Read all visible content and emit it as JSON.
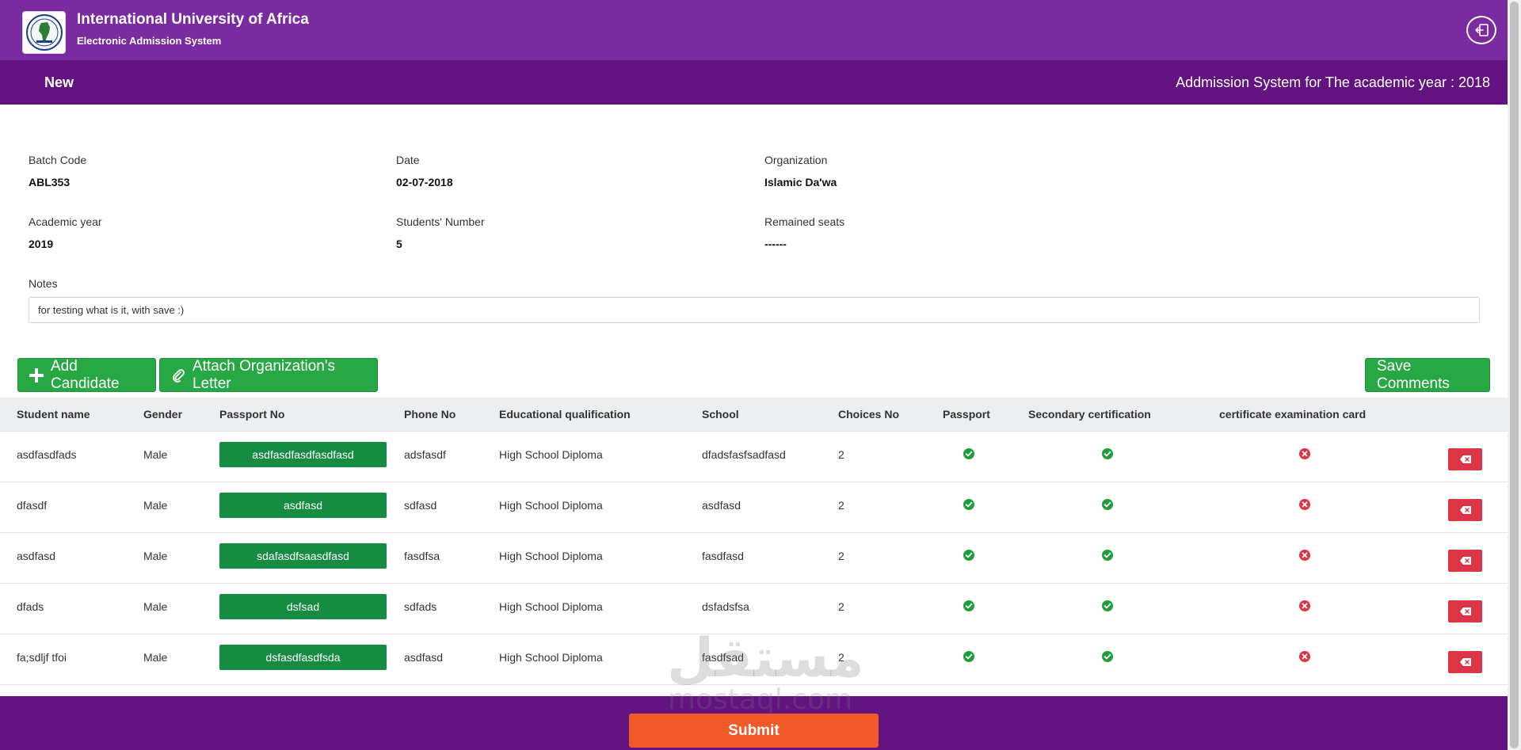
{
  "header": {
    "title": "International University of Africa",
    "subtitle": "Electronic Admission System",
    "logo_icon": "university-seal-icon",
    "logout_icon": "logout-icon"
  },
  "subheader": {
    "left": "New",
    "right": "Addmission System for The academic year : 2018"
  },
  "info": {
    "batch_code_label": "Batch Code",
    "batch_code": "ABL353",
    "date_label": "Date",
    "date": "02-07-2018",
    "organization_label": "Organization",
    "organization": "Islamic Da'wa",
    "academic_year_label": "Academic year",
    "academic_year": "2019",
    "students_number_label": "Students' Number",
    "students_number": "5",
    "remained_seats_label": "Remained seats",
    "remained_seats": "------",
    "notes_label": "Notes",
    "notes_value": "for testing what is it, with save :)"
  },
  "actions": {
    "add_candidate": "Add Candidate",
    "attach_letter": "Attach Organization's Letter",
    "save_comments": "Save Comments"
  },
  "table": {
    "headers": {
      "student_name": "Student name",
      "gender": "Gender",
      "passport_no": "Passport No",
      "phone_no": "Phone No",
      "education": "Educational qualification",
      "school": "School",
      "choices_no": "Choices No",
      "passport": "Passport",
      "secondary": "Secondary certification",
      "exam_card": "certificate examination card"
    },
    "rows": [
      {
        "name": "asdfasdfads",
        "gender": "Male",
        "passport_no": "asdfasdfasdfasdfasd",
        "phone": "adsfasdf",
        "education": "High School Diploma",
        "school": "dfadsfasfsadfasd",
        "choices": "2",
        "passport": true,
        "secondary": true,
        "exam_card": false
      },
      {
        "name": "dfasdf",
        "gender": "Male",
        "passport_no": "asdfasd",
        "phone": "sdfasd",
        "education": "High School Diploma",
        "school": "asdfasd",
        "choices": "2",
        "passport": true,
        "secondary": true,
        "exam_card": false
      },
      {
        "name": "asdfasd",
        "gender": "Male",
        "passport_no": "sdafasdfsaasdfasd",
        "phone": "fasdfsa",
        "education": "High School Diploma",
        "school": "fasdfasd",
        "choices": "2",
        "passport": true,
        "secondary": true,
        "exam_card": false
      },
      {
        "name": "dfads",
        "gender": "Male",
        "passport_no": "dsfsad",
        "phone": "sdfads",
        "education": "High School Diploma",
        "school": "dsfadsfsa",
        "choices": "2",
        "passport": true,
        "secondary": true,
        "exam_card": false
      },
      {
        "name": "fa;sdljf tfoi",
        "gender": "Male",
        "passport_no": "dsfasdfasdfsda",
        "phone": "asdfasd",
        "education": "High School Diploma",
        "school": "fasdfsad",
        "choices": "2",
        "passport": true,
        "secondary": true,
        "exam_card": false
      }
    ]
  },
  "footer": {
    "submit": "Submit"
  },
  "watermark": {
    "arabic": "مستقل",
    "latin": "mostaql.com"
  },
  "colors": {
    "header_bg": "#7a2ba0",
    "subheader_bg": "#62137f",
    "primary_green": "#28a745",
    "passport_green": "#168b42",
    "danger": "#dc3545",
    "submit_orange": "#f05a28"
  }
}
